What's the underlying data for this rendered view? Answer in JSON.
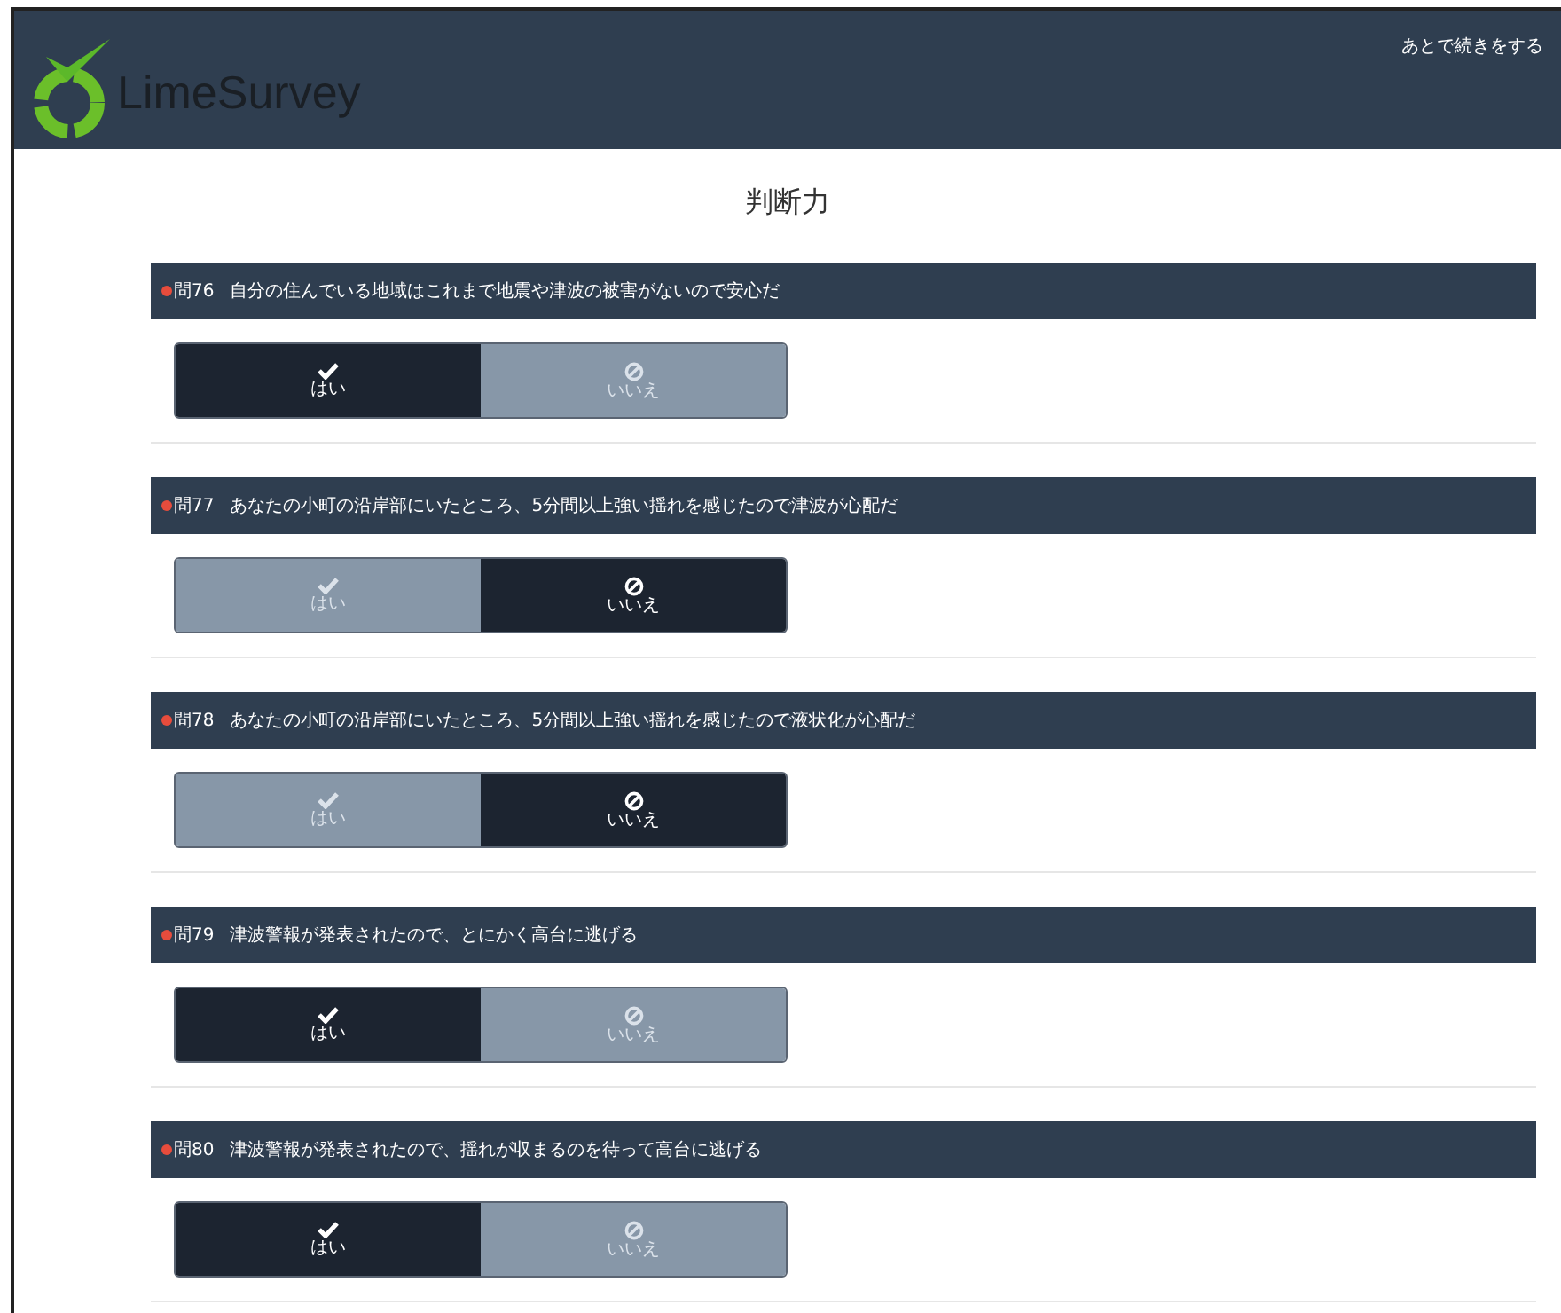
{
  "header": {
    "logo_text": "LimeSurvey",
    "resume_link": "あとで続きをする"
  },
  "group_title": "判断力",
  "questions": [
    {
      "number": "問76",
      "text": "自分の住んでいる地域はこれまで地震や津波の被害がないので安心だ",
      "options": [
        {
          "kind": "yes",
          "label": "はい",
          "selected": true
        },
        {
          "kind": "no",
          "label": "いいえ",
          "selected": false
        }
      ]
    },
    {
      "number": "問77",
      "text": "あなたの小町の沿岸部にいたところ、5分間以上強い揺れを感じたので津波が心配だ",
      "options": [
        {
          "kind": "yes",
          "label": "はい",
          "selected": false
        },
        {
          "kind": "no",
          "label": "いいえ",
          "selected": true
        }
      ]
    },
    {
      "number": "問78",
      "text": "あなたの小町の沿岸部にいたところ、5分間以上強い揺れを感じたので液状化が心配だ",
      "options": [
        {
          "kind": "yes",
          "label": "はい",
          "selected": false
        },
        {
          "kind": "no",
          "label": "いいえ",
          "selected": true
        }
      ]
    },
    {
      "number": "問79",
      "text": "津波警報が発表されたので、とにかく高台に逃げる",
      "options": [
        {
          "kind": "yes",
          "label": "はい",
          "selected": true
        },
        {
          "kind": "no",
          "label": "いいえ",
          "selected": false
        }
      ]
    },
    {
      "number": "問80",
      "text": "津波警報が発表されたので、揺れが収まるのを待って高台に逃げる",
      "options": [
        {
          "kind": "yes",
          "label": "はい",
          "selected": true
        },
        {
          "kind": "no",
          "label": "いいえ",
          "selected": false
        }
      ]
    }
  ]
}
